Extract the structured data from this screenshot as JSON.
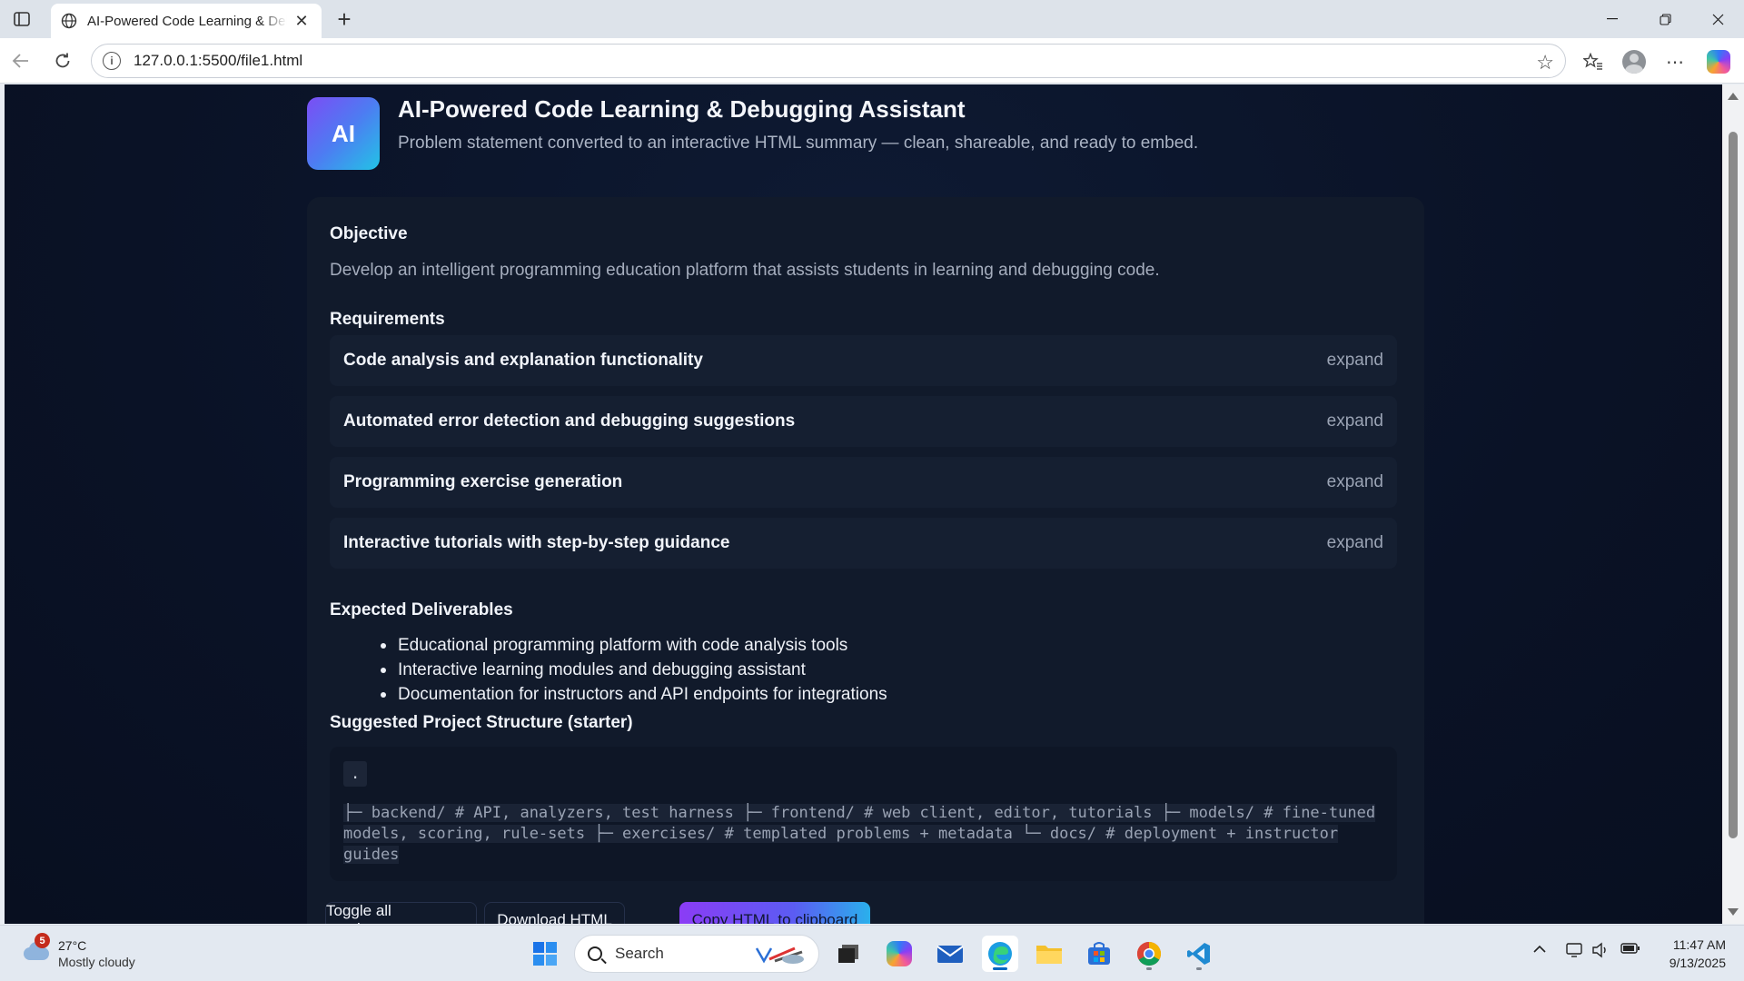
{
  "browser": {
    "tab_title": "AI-Powered Code Learning & Debugging Assistant",
    "url": "127.0.0.1:5500/file1.html"
  },
  "page": {
    "logo_text": "AI",
    "title": "AI-Powered Code Learning & Debugging Assistant",
    "subtitle": "Problem statement converted to an interactive HTML summary — clean, shareable, and ready to embed.",
    "objective_heading": "Objective",
    "objective_text": "Develop an intelligent programming education platform that assists students in learning and debugging code.",
    "requirements_heading": "Requirements",
    "requirements": [
      {
        "label": "Code analysis and explanation functionality",
        "toggle": "expand"
      },
      {
        "label": "Automated error detection and debugging suggestions",
        "toggle": "expand"
      },
      {
        "label": "Programming exercise generation",
        "toggle": "expand"
      },
      {
        "label": "Interactive tutorials with step-by-step guidance",
        "toggle": "expand"
      }
    ],
    "deliverables_heading": "Expected Deliverables",
    "deliverables": [
      "Educational programming platform with code analysis tools",
      "Interactive learning modules and debugging assistant",
      "Documentation for instructors and API endpoints for integrations"
    ],
    "structure_heading": "Suggested Project Structure (starter)",
    "structure_root": ".",
    "structure_tree": "├─ backend/         # API, analyzers, test harness ├─ frontend/        # web client, editor, tutorials ├─ models/          # fine-tuned models, scoring, rule-sets ├─ exercises/       # templated problems + metadata └─ docs/            # deployment + instructor guides",
    "buttons": {
      "toggle_all": "Toggle all requirements",
      "download": "Download HTML",
      "copy": "Copy HTML to clipboard"
    }
  },
  "taskbar": {
    "weather_badge": "5",
    "weather_temp": "27°C",
    "weather_desc": "Mostly cloudy",
    "search_placeholder": "Search",
    "time": "11:47 AM",
    "date": "9/13/2025"
  },
  "colors": {
    "page_bg": "#0b1428",
    "card_bg": "#111a2b",
    "accent_start": "#8b3cf5",
    "accent_end": "#2ab0ec"
  }
}
